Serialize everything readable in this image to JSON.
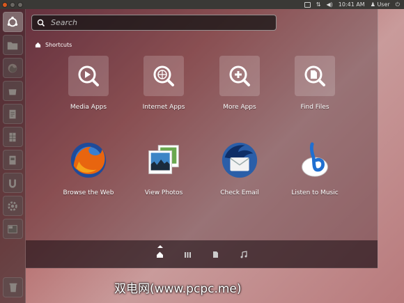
{
  "topbar": {
    "time": "10:41 AM",
    "user": "User"
  },
  "search": {
    "placeholder": "Search"
  },
  "section": {
    "title": "Shortcuts"
  },
  "categories": [
    {
      "label": "Media Apps",
      "icon": "media-apps-icon"
    },
    {
      "label": "Internet Apps",
      "icon": "internet-apps-icon"
    },
    {
      "label": "More Apps",
      "icon": "more-apps-icon"
    },
    {
      "label": "Find Files",
      "icon": "find-files-icon"
    }
  ],
  "apps": [
    {
      "label": "Browse the Web",
      "icon": "firefox-icon"
    },
    {
      "label": "View Photos",
      "icon": "photos-icon"
    },
    {
      "label": "Check Email",
      "icon": "thunderbird-icon"
    },
    {
      "label": "Listen to Music",
      "icon": "banshee-icon"
    }
  ],
  "lenses": [
    "home-lens-icon",
    "applications-lens-icon",
    "files-lens-icon",
    "music-lens-icon"
  ],
  "watermark": "双电网(www.pcpc.me)"
}
